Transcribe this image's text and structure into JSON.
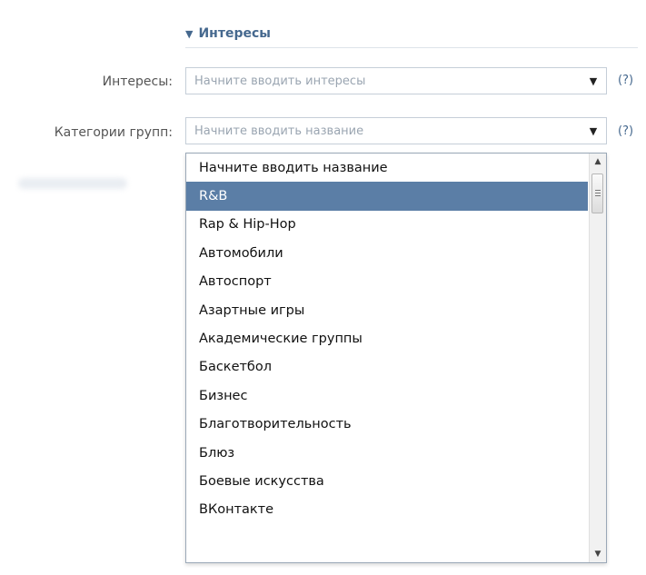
{
  "section": {
    "title": "Интересы"
  },
  "interests": {
    "label": "Интересы:",
    "placeholder": "Начните вводить интересы",
    "help": "(?)"
  },
  "group_categories": {
    "label": "Категории групп:",
    "placeholder": "Начните вводить название",
    "help": "(?)",
    "dropdown": {
      "header": "Начните вводить название",
      "selected_index": 0,
      "items": [
        "R&B",
        "Rap & Hip-Hop",
        "Автомобили",
        "Автоспорт",
        "Азартные игры",
        "Академические группы",
        "Баскетбол",
        "Бизнес",
        "Благотворительность",
        "Блюз",
        "Боевые искусства",
        "ВКонтакте"
      ]
    }
  },
  "icons": {
    "section_toggle": "triangle-down-icon",
    "combo_arrow": "caret-down-icon",
    "scroll_up": "scroll-up-icon",
    "scroll_down": "scroll-down-icon"
  }
}
